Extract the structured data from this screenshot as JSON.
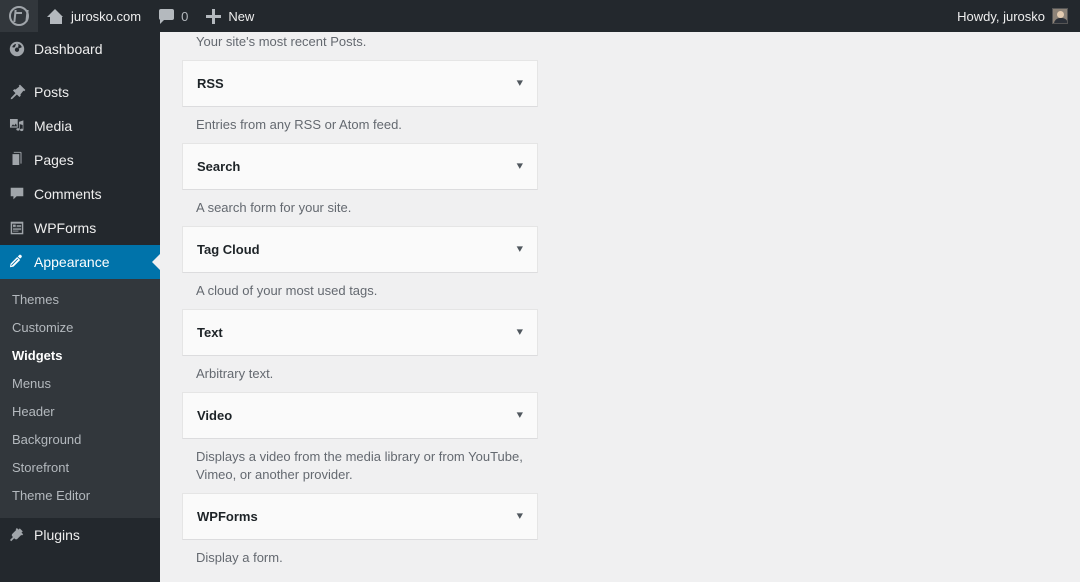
{
  "adminbar": {
    "logo_icon": "wordpress-logo-icon",
    "home_icon": "home-icon",
    "site_name": "jurosko.com",
    "comments_icon": "comment-bubble-icon",
    "comments_count": "0",
    "new_icon": "plus-icon",
    "new_label": "New",
    "howdy": "Howdy, jurosko",
    "avatar_icon": "user-avatar"
  },
  "sidebar": {
    "accent_color": "#0073aa",
    "background_color": "#23282d",
    "submenu_background_color": "#32373c",
    "items": [
      {
        "label": "Dashboard",
        "icon": "dashboard-icon",
        "current": false
      },
      {
        "label": "Posts",
        "icon": "pin-icon",
        "current": false
      },
      {
        "label": "Media",
        "icon": "media-icon",
        "current": false
      },
      {
        "label": "Pages",
        "icon": "pages-icon",
        "current": false
      },
      {
        "label": "Comments",
        "icon": "comment-icon",
        "current": false
      },
      {
        "label": "WPForms",
        "icon": "wpforms-icon",
        "current": false
      },
      {
        "label": "Appearance",
        "icon": "appearance-icon",
        "current": true
      },
      {
        "label": "Plugins",
        "icon": "plugins-icon",
        "current": false
      }
    ],
    "submenu": [
      {
        "label": "Themes",
        "current": false
      },
      {
        "label": "Customize",
        "current": false
      },
      {
        "label": "Widgets",
        "current": true
      },
      {
        "label": "Menus",
        "current": false
      },
      {
        "label": "Header",
        "current": false
      },
      {
        "label": "Background",
        "current": false
      },
      {
        "label": "Storefront",
        "current": false
      },
      {
        "label": "Theme Editor",
        "current": false
      }
    ]
  },
  "main": {
    "top_description": "Your site's most recent Posts.",
    "arrow_glyph": "▾",
    "widgets": [
      {
        "title": "RSS",
        "description": "Entries from any RSS or Atom feed."
      },
      {
        "title": "Search",
        "description": "A search form for your site."
      },
      {
        "title": "Tag Cloud",
        "description": "A cloud of your most used tags."
      },
      {
        "title": "Text",
        "description": "Arbitrary text."
      },
      {
        "title": "Video",
        "description": "Displays a video from the media library or from YouTube, Vimeo, or another provider."
      },
      {
        "title": "WPForms",
        "description": "Display a form."
      }
    ]
  }
}
